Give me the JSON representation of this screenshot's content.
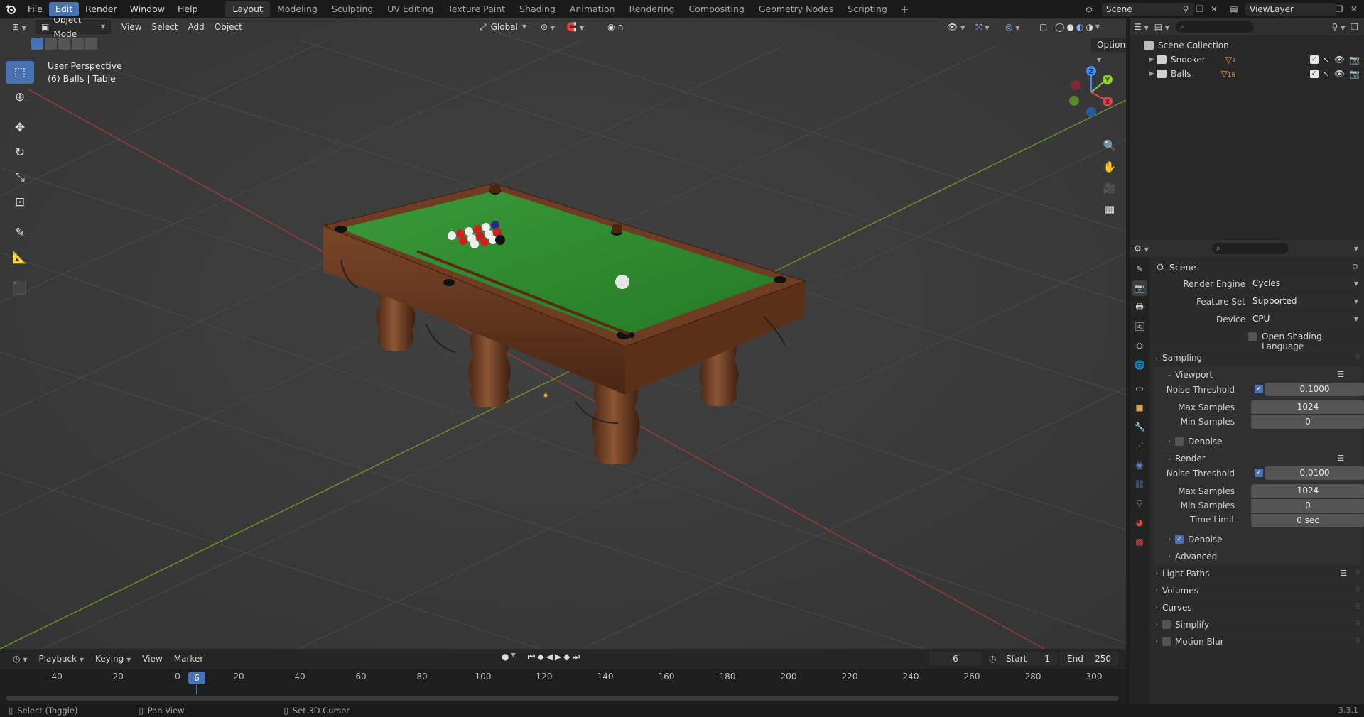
{
  "topbar": {
    "menus": [
      "File",
      "Edit",
      "Render",
      "Window",
      "Help"
    ],
    "active_menu": "Edit",
    "workspaces": [
      "Layout",
      "Modeling",
      "Sculpting",
      "UV Editing",
      "Texture Paint",
      "Shading",
      "Animation",
      "Rendering",
      "Compositing",
      "Geometry Nodes",
      "Scripting"
    ],
    "active_workspace": "Layout",
    "scene_name": "Scene",
    "view_layer": "ViewLayer"
  },
  "viewport": {
    "mode": "Object Mode",
    "menus": [
      "View",
      "Select",
      "Add",
      "Object"
    ],
    "orientation": "Global",
    "options": "Options",
    "perspective": "User Perspective",
    "context": "(6) Balls | Table",
    "gizmo_axes": [
      "X",
      "Y",
      "Z"
    ]
  },
  "timeline": {
    "menus": [
      "Playback",
      "Keying",
      "View",
      "Marker"
    ],
    "current_frame": "6",
    "start_label": "Start",
    "start": "1",
    "end_label": "End",
    "end": "250",
    "ticks": [
      "-40",
      "-20",
      "0",
      "20",
      "40",
      "60",
      "80",
      "100",
      "120",
      "140",
      "160",
      "180",
      "200",
      "220",
      "240",
      "260",
      "280",
      "300"
    ],
    "cursor": "6"
  },
  "statusbar": {
    "items": [
      "Select (Toggle)",
      "Pan View",
      "Set 3D Cursor"
    ],
    "version": "3.3.1"
  },
  "outliner": {
    "root": "Scene Collection",
    "collections": [
      {
        "name": "Snooker",
        "badge": "7"
      },
      {
        "name": "Balls",
        "badge": "16"
      }
    ]
  },
  "properties": {
    "title": "Scene",
    "render_engine_label": "Render Engine",
    "render_engine": "Cycles",
    "feature_set_label": "Feature Set",
    "feature_set": "Supported",
    "device_label": "Device",
    "device": "CPU",
    "osl_label": "Open Shading Language",
    "sampling": "Sampling",
    "viewport_section": "Viewport",
    "viewport_noise_label": "Noise Threshold",
    "viewport_noise": "0.1000",
    "viewport_max_label": "Max Samples",
    "viewport_max": "1024",
    "viewport_min_label": "Min Samples",
    "viewport_min": "0",
    "denoise_label": "Denoise",
    "render_section": "Render",
    "render_noise_label": "Noise Threshold",
    "render_noise": "0.0100",
    "render_max_label": "Max Samples",
    "render_max": "1024",
    "render_min_label": "Min Samples",
    "render_min": "0",
    "time_limit_label": "Time Limit",
    "time_limit": "0 sec",
    "render_denoise_label": "Denoise",
    "advanced": "Advanced",
    "light_paths": "Light Paths",
    "volumes": "Volumes",
    "curves": "Curves",
    "simplify": "Simplify",
    "motion_blur": "Motion Blur"
  },
  "colors": {
    "accent": "#4772b3",
    "axis_x": "#e3434f",
    "axis_y": "#8ccf2f",
    "axis_z": "#3f8df3",
    "felt": "#2f8a2f",
    "wood": "#6a3a20"
  }
}
